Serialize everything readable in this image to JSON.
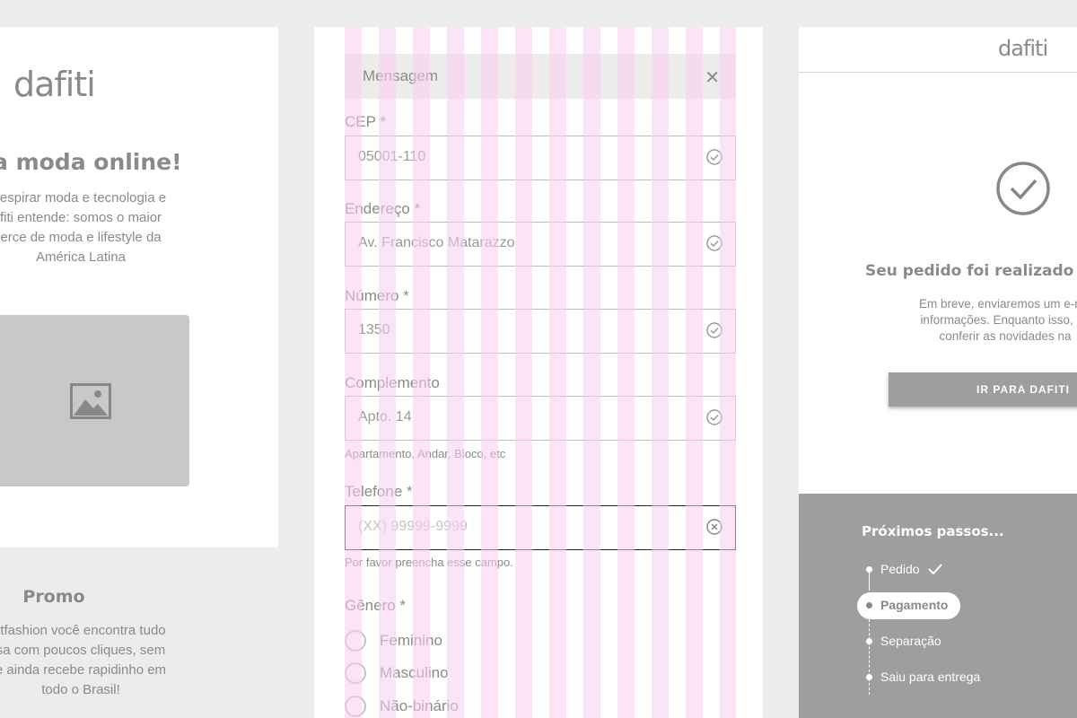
{
  "left": {
    "logo": "dafiti",
    "headline": "a moda online!",
    "description": "respirar moda e tecnologia e\nfiti entende: somos o maior\nerce de moda e lifestyle da\nAmérica Latina",
    "image_icon": "image-icon",
    "promo_title": "Promo",
    "promo_description": "rtfashion você encontra tudo\nsa com poucos cliques, sem\ne ainda recebe rapidinho em\ntodo o Brasil!"
  },
  "form": {
    "message": {
      "text": "Mensagem",
      "close_icon": "close-icon"
    },
    "fields": [
      {
        "label": "CEP *",
        "value": "05001-110",
        "icon": "check-circle-icon"
      },
      {
        "label": "Endereço *",
        "value": "Av. Francisco Matarazzo",
        "icon": "check-circle-icon"
      },
      {
        "label": "Número *",
        "value": "1350",
        "icon": "check-circle-icon"
      },
      {
        "label": "Complemento",
        "value": "Apto. 14",
        "icon": "check-circle-icon",
        "help": "Apartamento, Andar, Bloco, etc"
      },
      {
        "label": "Telefone *",
        "placeholder": "(XX) 99999-9999",
        "icon": "error-circle-icon",
        "help": "Por favor preencha esse campo."
      }
    ],
    "gender": {
      "label": "Gênero *",
      "options": [
        "Feminino",
        "Masculino",
        "Não-binário"
      ]
    }
  },
  "right": {
    "logo": "dafiti",
    "title": "Seu pedido foi realizado co",
    "message": "Em breve, enviaremos um e-ma\ninformações. Enquanto isso, ap\nconferir as novidades na",
    "button": "IR PARA DAFITI",
    "steps_title": "Próximos passos...",
    "steps": [
      "Pedido",
      "Pagamento",
      "Separação",
      "Saiu para entrega"
    ]
  },
  "colors": {
    "background": "#ececec",
    "text": "#8a8a8a",
    "stripe": "#facdf0",
    "steps_bg": "#9e9e9e"
  }
}
